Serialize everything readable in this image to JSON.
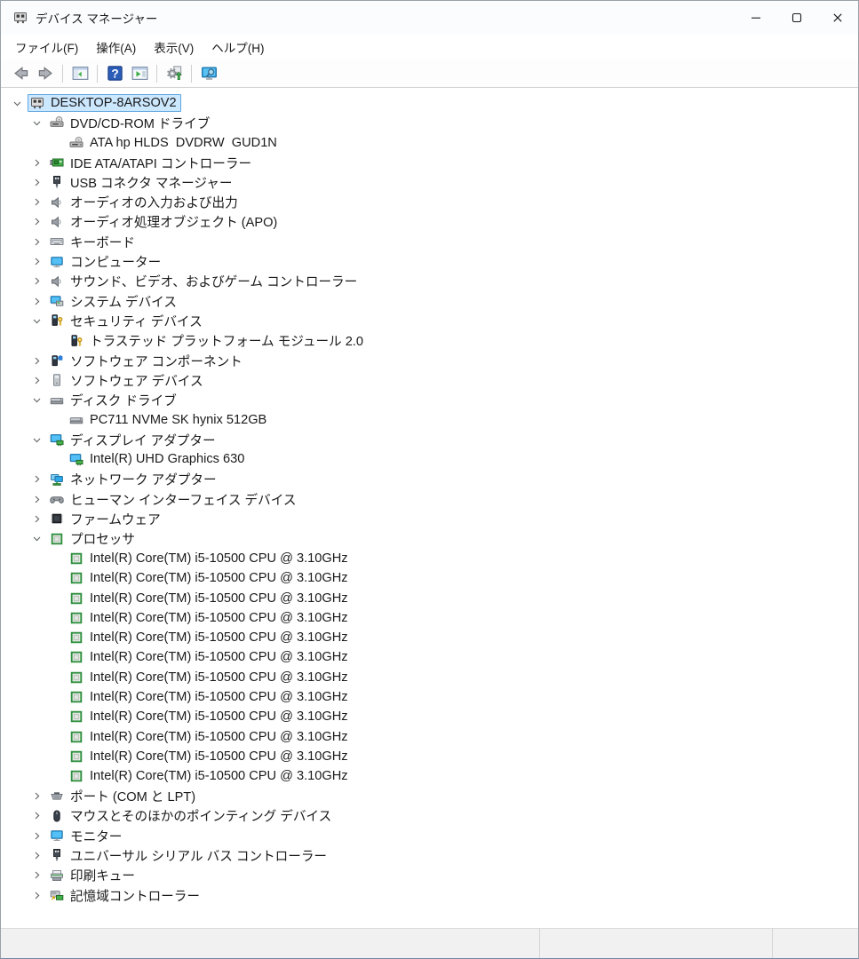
{
  "window": {
    "title": "デバイス マネージャー",
    "controls": [
      {
        "key": "minimize",
        "icon": "minimize"
      },
      {
        "key": "maximize",
        "icon": "maximize"
      },
      {
        "key": "close",
        "icon": "close"
      }
    ]
  },
  "menu": {
    "items": [
      {
        "key": "file",
        "label": "ファイル(F)"
      },
      {
        "key": "action",
        "label": "操作(A)"
      },
      {
        "key": "view",
        "label": "表示(V)"
      },
      {
        "key": "help",
        "label": "ヘルプ(H)"
      }
    ]
  },
  "toolbar": {
    "buttons": [
      {
        "key": "back",
        "icon": "nav-back",
        "separator_after": false
      },
      {
        "key": "forward",
        "icon": "nav-forward",
        "separator_after": true
      },
      {
        "key": "show-console-tree",
        "icon": "console-tree",
        "separator_after": true
      },
      {
        "key": "help",
        "icon": "help",
        "separator_after": false
      },
      {
        "key": "properties",
        "icon": "properties",
        "separator_after": true
      },
      {
        "key": "scan-hardware-changes",
        "icon": "scan-hardware",
        "separator_after": true
      },
      {
        "key": "remote-computer",
        "icon": "remote-monitor",
        "separator_after": false
      }
    ]
  },
  "tree": {
    "items": [
      {
        "label": "DESKTOP-8ARSOV2",
        "level": 0,
        "state": "expanded",
        "icon": "computer-chip",
        "selected": true
      },
      {
        "label": "DVD/CD-ROM ドライブ",
        "level": 1,
        "state": "expanded",
        "icon": "dvd-drive"
      },
      {
        "label": "ATA hp HLDS  DVDRW  GUD1N",
        "level": 2,
        "state": "leaf",
        "icon": "dvd-drive"
      },
      {
        "label": "IDE ATA/ATAPI コントローラー",
        "level": 1,
        "state": "collapsed",
        "icon": "ide-controller"
      },
      {
        "label": "USB コネクタ マネージャー",
        "level": 1,
        "state": "collapsed",
        "icon": "usb-plug"
      },
      {
        "label": "オーディオの入力および出力",
        "level": 1,
        "state": "collapsed",
        "icon": "speaker"
      },
      {
        "label": "オーディオ処理オブジェクト (APO)",
        "level": 1,
        "state": "collapsed",
        "icon": "speaker"
      },
      {
        "label": "キーボード",
        "level": 1,
        "state": "collapsed",
        "icon": "keyboard"
      },
      {
        "label": "コンピューター",
        "level": 1,
        "state": "collapsed",
        "icon": "monitor"
      },
      {
        "label": "サウンド、ビデオ、およびゲーム コントローラー",
        "level": 1,
        "state": "collapsed",
        "icon": "speaker"
      },
      {
        "label": "システム デバイス",
        "level": 1,
        "state": "collapsed",
        "icon": "system-device"
      },
      {
        "label": "セキュリティ デバイス",
        "level": 1,
        "state": "expanded",
        "icon": "security-device"
      },
      {
        "label": "トラステッド プラットフォーム モジュール 2.0",
        "level": 2,
        "state": "leaf",
        "icon": "security-device"
      },
      {
        "label": "ソフトウェア コンポーネント",
        "level": 1,
        "state": "collapsed",
        "icon": "software-component"
      },
      {
        "label": "ソフトウェア デバイス",
        "level": 1,
        "state": "collapsed",
        "icon": "software-device"
      },
      {
        "label": "ディスク ドライブ",
        "level": 1,
        "state": "expanded",
        "icon": "disk-drive"
      },
      {
        "label": "PC711 NVMe SK hynix 512GB",
        "level": 2,
        "state": "leaf",
        "icon": "disk-drive"
      },
      {
        "label": "ディスプレイ アダプター",
        "level": 1,
        "state": "expanded",
        "icon": "display-adapter"
      },
      {
        "label": "Intel(R) UHD Graphics 630",
        "level": 2,
        "state": "leaf",
        "icon": "display-adapter"
      },
      {
        "label": "ネットワーク アダプター",
        "level": 1,
        "state": "collapsed",
        "icon": "network-adapter"
      },
      {
        "label": "ヒューマン インターフェイス デバイス",
        "level": 1,
        "state": "collapsed",
        "icon": "hid-device"
      },
      {
        "label": "ファームウェア",
        "level": 1,
        "state": "collapsed",
        "icon": "firmware-chip"
      },
      {
        "label": "プロセッサ",
        "level": 1,
        "state": "expanded",
        "icon": "processor-chip"
      },
      {
        "label": "Intel(R) Core(TM) i5-10500 CPU @ 3.10GHz",
        "level": 2,
        "state": "leaf",
        "icon": "processor-chip"
      },
      {
        "label": "Intel(R) Core(TM) i5-10500 CPU @ 3.10GHz",
        "level": 2,
        "state": "leaf",
        "icon": "processor-chip"
      },
      {
        "label": "Intel(R) Core(TM) i5-10500 CPU @ 3.10GHz",
        "level": 2,
        "state": "leaf",
        "icon": "processor-chip"
      },
      {
        "label": "Intel(R) Core(TM) i5-10500 CPU @ 3.10GHz",
        "level": 2,
        "state": "leaf",
        "icon": "processor-chip"
      },
      {
        "label": "Intel(R) Core(TM) i5-10500 CPU @ 3.10GHz",
        "level": 2,
        "state": "leaf",
        "icon": "processor-chip"
      },
      {
        "label": "Intel(R) Core(TM) i5-10500 CPU @ 3.10GHz",
        "level": 2,
        "state": "leaf",
        "icon": "processor-chip"
      },
      {
        "label": "Intel(R) Core(TM) i5-10500 CPU @ 3.10GHz",
        "level": 2,
        "state": "leaf",
        "icon": "processor-chip"
      },
      {
        "label": "Intel(R) Core(TM) i5-10500 CPU @ 3.10GHz",
        "level": 2,
        "state": "leaf",
        "icon": "processor-chip"
      },
      {
        "label": "Intel(R) Core(TM) i5-10500 CPU @ 3.10GHz",
        "level": 2,
        "state": "leaf",
        "icon": "processor-chip"
      },
      {
        "label": "Intel(R) Core(TM) i5-10500 CPU @ 3.10GHz",
        "level": 2,
        "state": "leaf",
        "icon": "processor-chip"
      },
      {
        "label": "Intel(R) Core(TM) i5-10500 CPU @ 3.10GHz",
        "level": 2,
        "state": "leaf",
        "icon": "processor-chip"
      },
      {
        "label": "Intel(R) Core(TM) i5-10500 CPU @ 3.10GHz",
        "level": 2,
        "state": "leaf",
        "icon": "processor-chip"
      },
      {
        "label": "ポート (COM と LPT)",
        "level": 1,
        "state": "collapsed",
        "icon": "serial-port"
      },
      {
        "label": "マウスとそのほかのポインティング デバイス",
        "level": 1,
        "state": "collapsed",
        "icon": "mouse"
      },
      {
        "label": "モニター",
        "level": 1,
        "state": "collapsed",
        "icon": "monitor"
      },
      {
        "label": "ユニバーサル シリアル バス コントローラー",
        "level": 1,
        "state": "collapsed",
        "icon": "usb-plug"
      },
      {
        "label": "印刷キュー",
        "level": 1,
        "state": "collapsed",
        "icon": "printer"
      },
      {
        "label": "記憶域コントローラー",
        "level": 1,
        "state": "collapsed",
        "icon": "storage-controller"
      }
    ]
  },
  "statusbar": {
    "panels": [
      {
        "text": ""
      },
      {
        "text": ""
      },
      {
        "text": ""
      }
    ]
  },
  "colors": {
    "selection_fill": "#cce8ff",
    "selection_border": "#60a6e0",
    "accent_green": "#43b04a",
    "accent_blue": "#2da7e8"
  }
}
